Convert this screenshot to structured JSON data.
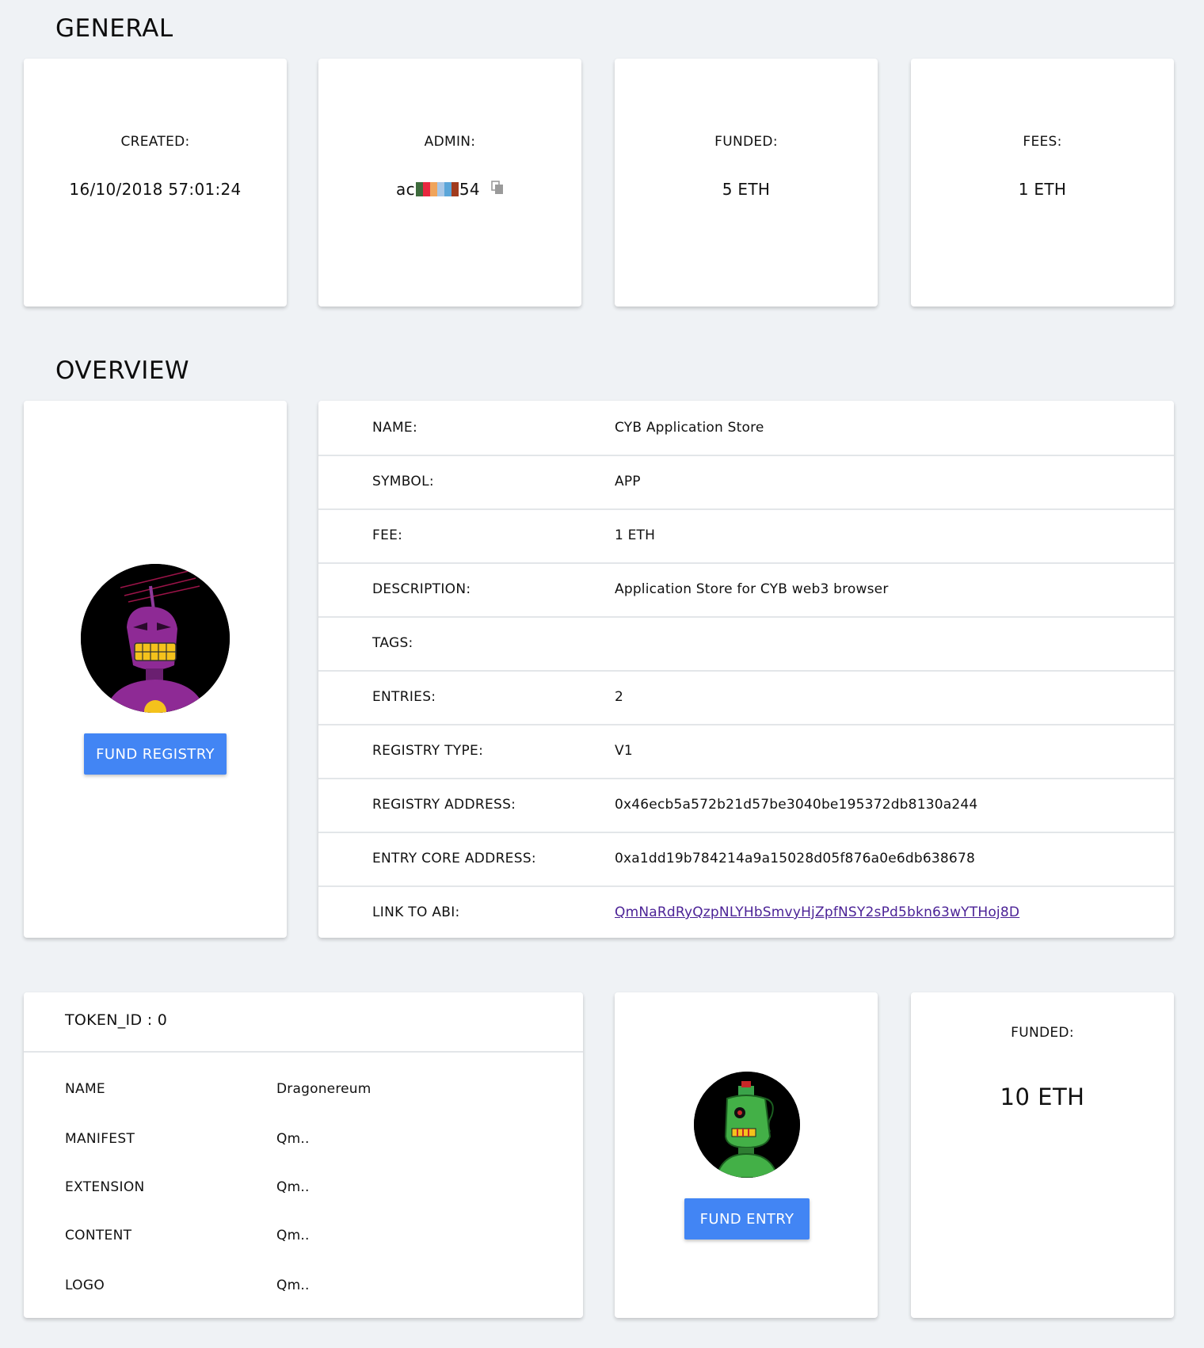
{
  "general": {
    "title": "GENERAL",
    "created": {
      "label": "CREATED:",
      "value": "16/10/2018 57:01:24"
    },
    "admin": {
      "label": "ADMIN:",
      "prefix": "ac",
      "suffix": "54",
      "identicon_colors": [
        "#3d6b3c",
        "#e8283f",
        "#f0a45b",
        "#a9c7e6",
        "#5ba6d9",
        "#a13b1e"
      ],
      "copy_icon": "copy-icon"
    },
    "funded": {
      "label": "FUNDED:",
      "value": "5 ETH"
    },
    "fees": {
      "label": "FEES:",
      "value": "1 ETH"
    }
  },
  "overview": {
    "title": "OVERVIEW",
    "avatar_icon": "purple-robot-avatar",
    "fund_button": "FUND REGISTRY",
    "rows": [
      {
        "key": "NAME:",
        "value": "CYB Application Store"
      },
      {
        "key": "SYMBOL:",
        "value": "APP"
      },
      {
        "key": "FEE:",
        "value": "1 ETH"
      },
      {
        "key": "DESCRIPTION:",
        "value": "Application Store for CYB web3 browser"
      },
      {
        "key": "TAGS:",
        "value": ""
      },
      {
        "key": "ENTRIES:",
        "value": "2"
      },
      {
        "key": "REGISTRY TYPE:",
        "value": "V1"
      },
      {
        "key": "REGISTRY ADDRESS:",
        "value": "0x46ecb5a572b21d57be3040be195372db8130a244"
      },
      {
        "key": "ENTRY CORE ADDRESS:",
        "value": "0xa1dd19b784214a9a15028d05f876a0e6db638678"
      },
      {
        "key": "LINK TO ABI:",
        "value": "QmNaRdRyQzpNLYHbSmvyHjZpfNSY2sPd5bkn63wYTHoj8D"
      }
    ]
  },
  "token": {
    "header": "TOKEN_ID : 0",
    "rows": [
      {
        "key": "NAME",
        "value": "Dragonereum"
      },
      {
        "key": "MANIFEST",
        "value": "Qm.."
      },
      {
        "key": "EXTENSION",
        "value": "Qm.."
      },
      {
        "key": "CONTENT",
        "value": "Qm.."
      },
      {
        "key": "LOGO",
        "value": "Qm.."
      }
    ]
  },
  "entry": {
    "avatar_icon": "green-robot-avatar",
    "fund_button": "FUND ENTRY"
  },
  "entry_funded": {
    "label": "FUNDED:",
    "value": "10 ETH"
  },
  "colors": {
    "accent": "#4285f4",
    "link": "#4b2296",
    "background": "#eff2f5"
  }
}
